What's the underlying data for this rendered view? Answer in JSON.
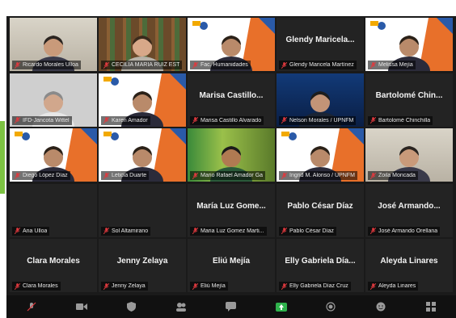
{
  "tiles": [
    {
      "label": "Ricardo Morales Ulloa",
      "kind": "video-office"
    },
    {
      "label": "CECILIA MARIA RUIZ EST",
      "kind": "video-bookshelf",
      "active": true
    },
    {
      "label": "Fac. Humanidades",
      "kind": "video-banner"
    },
    {
      "label": "Glendy Maricela Martínez",
      "kind": "name-only",
      "center": "Glendy Maricela..."
    },
    {
      "label": "Melissa Mejía",
      "kind": "video-banner"
    },
    {
      "label": "IFD-Jancota Wittel",
      "kind": "video-plain"
    },
    {
      "label": "Karen Amador",
      "kind": "video-banner"
    },
    {
      "label": "Marisa Castillo Alvarado",
      "kind": "name-only",
      "center": "Marisa Castillo..."
    },
    {
      "label": "Nelson Morales / UPNFM",
      "kind": "video-blue"
    },
    {
      "label": "Bartolomé Chinchilla",
      "kind": "name-only",
      "center": "Bartolomé Chin..."
    },
    {
      "label": "Diego López Díaz",
      "kind": "video-banner"
    },
    {
      "label": "Leticia Duarte",
      "kind": "video-banner"
    },
    {
      "label": "Mario Rafael Amador Ga",
      "kind": "video-art"
    },
    {
      "label": "Ingrid M. Alonso / UPNFM",
      "kind": "video-banner"
    },
    {
      "label": "Zoila Moncada",
      "kind": "video-office"
    },
    {
      "label": "Ana Ulloa",
      "kind": "empty"
    },
    {
      "label": "Sol Altamirano",
      "kind": "empty"
    },
    {
      "label": "Maria Luz Gomez Marti...",
      "kind": "name-only",
      "center": "María Luz Gome..."
    },
    {
      "label": "Pablo César Díaz",
      "kind": "name-only",
      "center": "Pablo César Díaz"
    },
    {
      "label": "José Armando Orellana",
      "kind": "name-only",
      "center": "José Armando..."
    },
    {
      "label": "Clara Morales",
      "kind": "name-only",
      "center": "Clara Morales"
    },
    {
      "label": "Jenny Zelaya",
      "kind": "name-only",
      "center": "Jenny Zelaya"
    },
    {
      "label": "Eliú Mejía",
      "kind": "name-only",
      "center": "Eliú Mejía"
    },
    {
      "label": "Elly Gabriela Díaz Cruz",
      "kind": "name-only",
      "center": "Elly Gabriela Día..."
    },
    {
      "label": "Aleyda Linares",
      "kind": "name-only",
      "center": "Aleyda Linares"
    }
  ],
  "colors": {
    "muted": "#e0393e",
    "active_border": "#d8d23a",
    "banner_orange": "#e8702a",
    "banner_blue": "#2a5aa8"
  },
  "toolbar": {
    "items": [
      {
        "icon": "mute-icon"
      },
      {
        "icon": "video-icon"
      },
      {
        "icon": "security-icon"
      },
      {
        "icon": "participants-icon"
      },
      {
        "icon": "chat-icon"
      },
      {
        "icon": "share-screen-icon"
      },
      {
        "icon": "record-icon"
      },
      {
        "icon": "reactions-icon"
      },
      {
        "icon": "apps-icon"
      }
    ]
  }
}
